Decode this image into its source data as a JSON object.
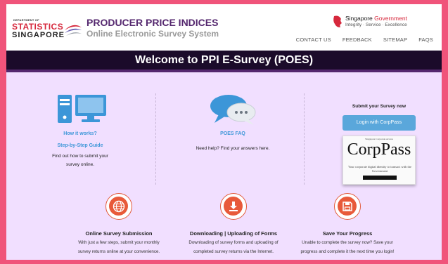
{
  "header": {
    "logo": {
      "dept": "DEPARTMENT OF",
      "statistics": "STATISTICS",
      "singapore": "SINGAPORE"
    },
    "title": "PRODUCER PRICE INDICES",
    "subtitle": "Online Electronic Survey System",
    "gov_logo": {
      "singapore": "Singapore",
      "government": "Government",
      "tagline": "Integrity · Service · Excellence"
    },
    "nav": [
      "CONTACT US",
      "FEEDBACK",
      "SITEMAP",
      "FAQS"
    ]
  },
  "banner": {
    "title": "Welcome to PPI E-Survey (POES)"
  },
  "panels": {
    "how_it_works": {
      "title": "How it works?",
      "link": "Step-by-Step Guide",
      "desc_line1": "Find out how to submit your",
      "desc_line2": "survey online."
    },
    "faq": {
      "title": "POES FAQ",
      "desc": "Need help? Find your answers here."
    },
    "submit": {
      "title": "Submit your Survey now",
      "button": "Login with CorpPass",
      "corppass": {
        "top": "Singapore Corporate Access",
        "main": "CorpPass",
        "sub": "Your corporate digital identity to transact with the Government"
      }
    }
  },
  "features": [
    {
      "icon": "globe-icon",
      "title": "Online Survey Submission",
      "line1": "With just a few steps, submit your monthly",
      "line2": "survey returns online at your convenience."
    },
    {
      "icon": "download-icon",
      "title": "Downloading | Uploading of Forms",
      "line1": "Downloading of survey forms and uploading of",
      "line2": "completed survey returns via the Internet."
    },
    {
      "icon": "save-icon",
      "title": "Save Your Progress",
      "line1": "Unable to complete the survey now? Save your",
      "line2": "progress and complete it the next time you login!"
    }
  ],
  "colors": {
    "page_border": "#f0547a",
    "brand_purple": "#55286f",
    "banner": "#1b0b2a",
    "content_bg": "#f1dfff",
    "link_blue": "#3c96d8",
    "accent_orange": "#e85a3a"
  }
}
